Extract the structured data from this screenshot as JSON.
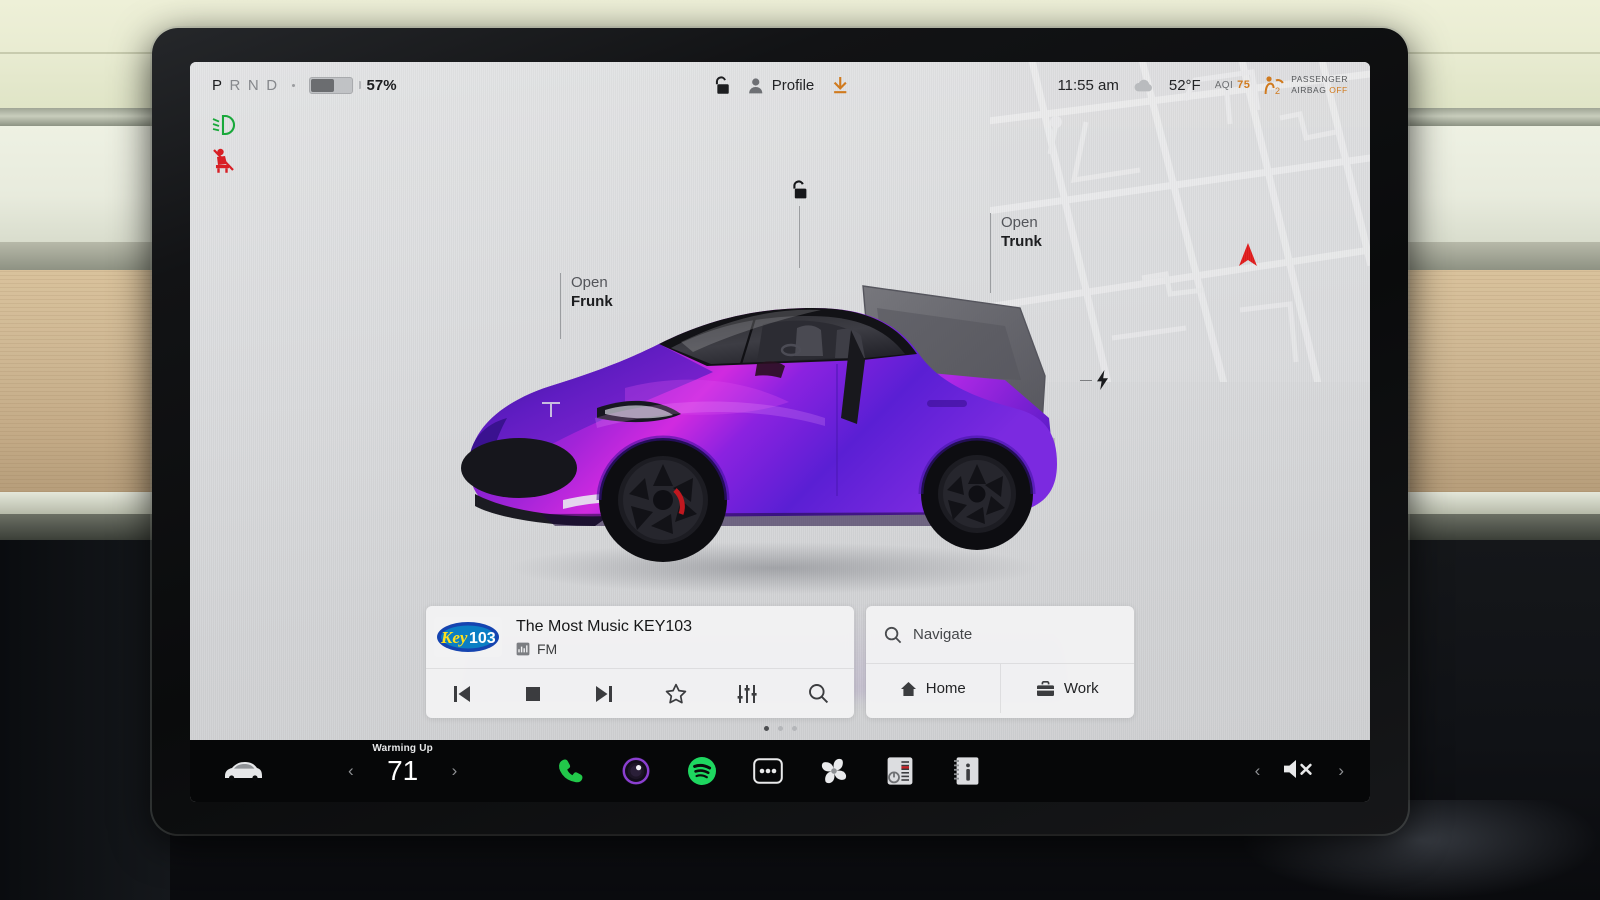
{
  "status_bar": {
    "gear_sequence": [
      "P",
      "R",
      "N",
      "D"
    ],
    "gear_active": "P",
    "battery_percent_label": "57%",
    "battery_percent_value": 57,
    "profile_label": "Profile",
    "lock_icon": "unlocked-padlock-icon",
    "profile_icon": "person-icon",
    "update_icon": "software-update-download-icon",
    "time": "11:55 am",
    "weather_icon": "cloud-icon",
    "temperature": "52°F",
    "aqi_label": "AQI",
    "aqi_value": "75",
    "airbag_line1": "PASSENGER",
    "airbag_line2": "AIRBAG",
    "airbag_status": "OFF",
    "accent_orange": "#d07a1e"
  },
  "indicators": [
    {
      "name": "low-beam-headlight-icon",
      "color": "#18a83a"
    },
    {
      "name": "seatbelt-warning-icon",
      "color": "#d81f25"
    }
  ],
  "car_view": {
    "frunk_line1": "Open",
    "frunk_line2": "Frunk",
    "trunk_line1": "Open",
    "trunk_line2": "Trunk",
    "lock_icon": "unlocked-padlock-icon",
    "charge_port_icon": "charge-bolt-icon",
    "car_model": "Model Y",
    "paint_primary": "#7b1fd8",
    "paint_secondary": "#c026d3",
    "paint_deep": "#3b1194"
  },
  "map": {
    "cursor_icon": "navigation-arrow-icon",
    "cursor_color": "#e01b1b"
  },
  "media": {
    "station_logo_text": "Key103",
    "title": "The Most Music KEY103",
    "source_icon": "radio-band-icon",
    "source_label": "FM",
    "controls": [
      {
        "name": "previous-track-button",
        "icon": "skip-back-icon"
      },
      {
        "name": "stop-button",
        "icon": "stop-square-icon"
      },
      {
        "name": "next-track-button",
        "icon": "skip-forward-icon"
      },
      {
        "name": "favorite-button",
        "icon": "star-outline-icon"
      },
      {
        "name": "equalizer-button",
        "icon": "sliders-icon"
      },
      {
        "name": "media-search-button",
        "icon": "search-icon"
      }
    ]
  },
  "navigation": {
    "search_placeholder": "Navigate",
    "search_icon": "search-icon",
    "shortcuts": [
      {
        "label": "Home",
        "icon": "home-icon"
      },
      {
        "label": "Work",
        "icon": "briefcase-icon"
      }
    ]
  },
  "page_dots": {
    "count": 3,
    "active_index": 0
  },
  "dock": {
    "car_icon": "vehicle-controls-icon",
    "climate_label": "Warming Up",
    "climate_temp": "71",
    "decrease_icon": "chevron-left-icon",
    "increase_icon": "chevron-right-icon",
    "apps": [
      {
        "name": "phone-app-icon",
        "label": "Phone",
        "color": "#22c84a"
      },
      {
        "name": "camera-app-icon",
        "label": "Camera",
        "color": "#8b3fd0"
      },
      {
        "name": "spotify-app-icon",
        "label": "Spotify",
        "color": "#1ed760"
      },
      {
        "name": "more-apps-icon",
        "label": "More",
        "color": "#ffffff"
      },
      {
        "name": "climate-fan-app-icon",
        "label": "Climate",
        "color": "#e8e9ea"
      },
      {
        "name": "tuner-app-icon",
        "label": "Tuner",
        "color": "#dcdde0"
      },
      {
        "name": "manual-info-app-icon",
        "label": "Owner's Manual",
        "color": "#dcdde0"
      }
    ],
    "volume": {
      "down_icon": "chevron-left-icon",
      "mute_icon": "speaker-muted-icon",
      "up_icon": "chevron-right-icon"
    }
  }
}
